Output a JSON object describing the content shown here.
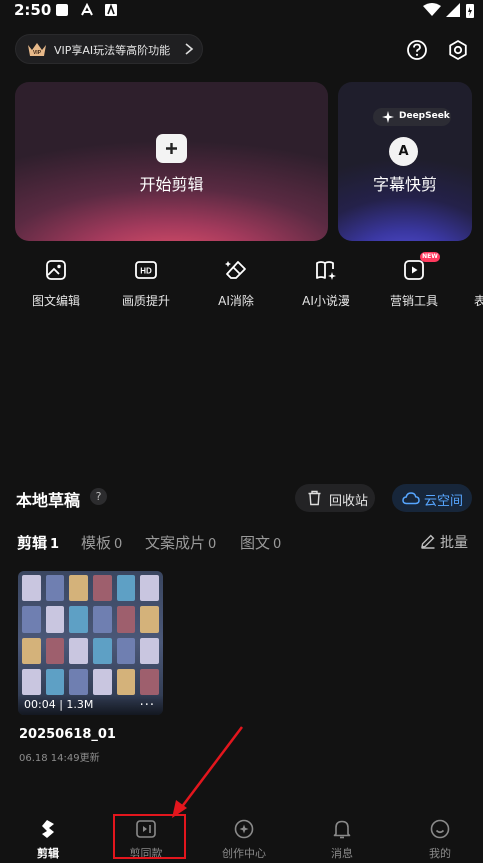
{
  "status_bar": {
    "time": "2:50"
  },
  "top": {
    "vip_text": "VIP享AI玩法等高阶功能"
  },
  "hero": {
    "main_label": "开始剪辑",
    "side_badge": "DeepSeek",
    "side_letter": "A",
    "side_label": "字幕快剪"
  },
  "tools": [
    {
      "label": "图文编辑",
      "icon": "image-edit-icon"
    },
    {
      "label": "画质提升",
      "icon": "hd-icon"
    },
    {
      "label": "AI消除",
      "icon": "eraser-icon"
    },
    {
      "label": "AI小说漫",
      "icon": "book-sparkle-icon"
    },
    {
      "label": "营销工具",
      "icon": "video-play-icon",
      "badge": "NEW"
    },
    {
      "label": "表"
    }
  ],
  "drafts": {
    "title": "本地草稿",
    "help": "?",
    "recycle_label": "回收站",
    "cloud_label": "云空间",
    "tabs": [
      {
        "label": "剪辑",
        "count": "1"
      },
      {
        "label": "模板",
        "count": "0"
      },
      {
        "label": "文案成片",
        "count": "0"
      },
      {
        "label": "图文",
        "count": "0"
      }
    ],
    "batch_label": "批量",
    "item": {
      "duration": "00:04",
      "size": "1.3M",
      "more": "···",
      "name": "20250618_01",
      "date": "06.18 14:49更新"
    }
  },
  "nav": [
    {
      "label": "剪辑",
      "icon": "scissors-icon"
    },
    {
      "label": "剪同款",
      "icon": "template-video-icon"
    },
    {
      "label": "创作中心",
      "icon": "compass-icon"
    },
    {
      "label": "消息",
      "icon": "bell-icon"
    },
    {
      "label": "我的",
      "icon": "smile-icon"
    }
  ],
  "colors": {
    "background": "#121212",
    "accent_blue": "#57a6ff",
    "annotation_red": "#e3161d"
  }
}
